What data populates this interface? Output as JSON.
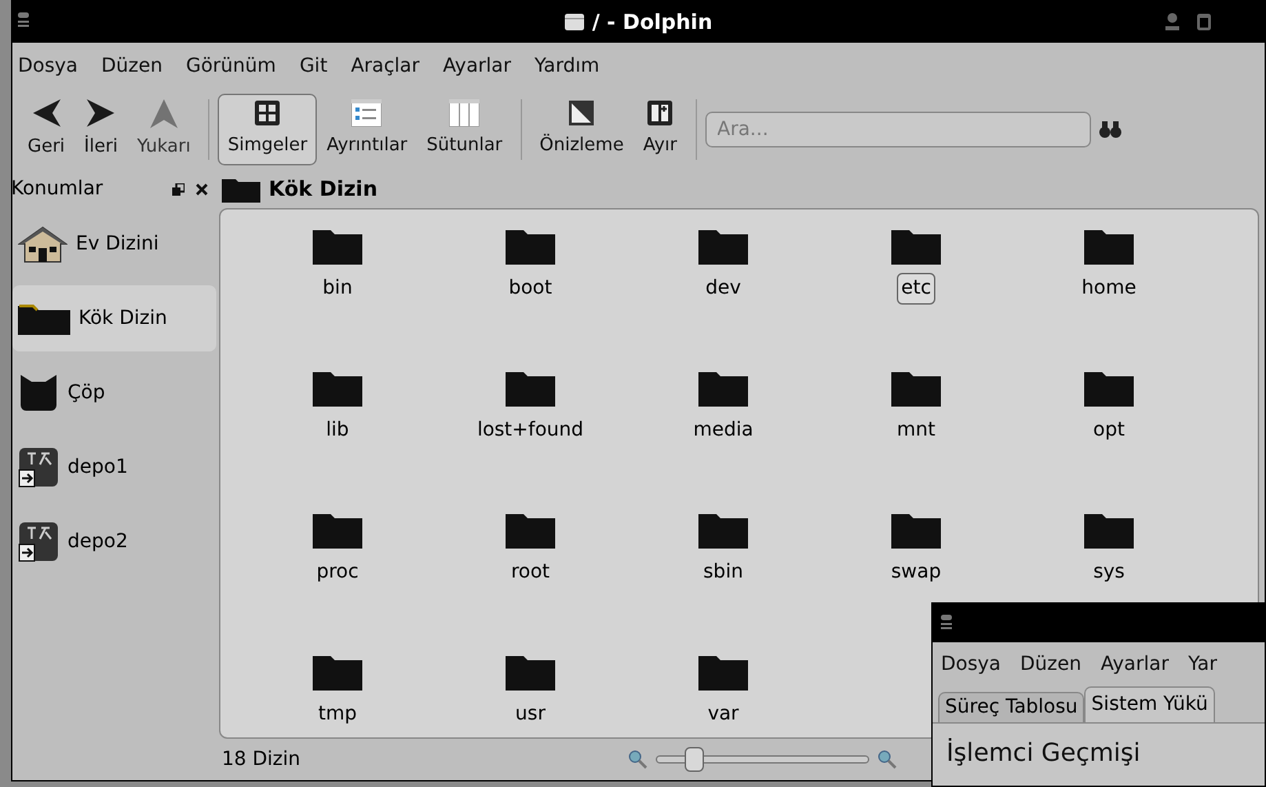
{
  "window": {
    "title": "/ - Dolphin"
  },
  "menu": [
    "Dosya",
    "Düzen",
    "Görünüm",
    "Git",
    "Araçlar",
    "Ayarlar",
    "Yardım"
  ],
  "toolbar": [
    {
      "kind": "back",
      "label": "Geri",
      "disabled": false,
      "selected": false
    },
    {
      "kind": "forward",
      "label": "İleri",
      "disabled": false,
      "selected": false
    },
    {
      "kind": "up",
      "label": "Yukarı",
      "disabled": true,
      "selected": false
    },
    {
      "kind": "icons",
      "label": "Simgeler",
      "disabled": false,
      "selected": true
    },
    {
      "kind": "details",
      "label": "Ayrıntılar",
      "disabled": false,
      "selected": false
    },
    {
      "kind": "columns",
      "label": "Sütunlar",
      "disabled": false,
      "selected": false
    },
    {
      "kind": "preview",
      "label": "Önizleme",
      "disabled": false,
      "selected": false
    },
    {
      "kind": "split",
      "label": "Ayır",
      "disabled": false,
      "selected": false
    }
  ],
  "search": {
    "placeholder": "Ara..."
  },
  "places": {
    "title": "Konumlar",
    "items": [
      {
        "kind": "home",
        "label": "Ev Dizini",
        "selected": false
      },
      {
        "kind": "folder",
        "label": "Kök Dizin",
        "selected": true
      },
      {
        "kind": "trash",
        "label": "Çöp",
        "selected": false
      },
      {
        "kind": "drive",
        "label": "depo1",
        "selected": false
      },
      {
        "kind": "drive",
        "label": "depo2",
        "selected": false
      }
    ]
  },
  "breadcrumb": "Kök Dizin",
  "files": [
    {
      "name": "bin",
      "selected": false
    },
    {
      "name": "boot",
      "selected": false
    },
    {
      "name": "dev",
      "selected": false
    },
    {
      "name": "etc",
      "selected": true
    },
    {
      "name": "home",
      "selected": false
    },
    {
      "name": "lib",
      "selected": false
    },
    {
      "name": "lost+found",
      "selected": false
    },
    {
      "name": "media",
      "selected": false
    },
    {
      "name": "mnt",
      "selected": false
    },
    {
      "name": "opt",
      "selected": false
    },
    {
      "name": "proc",
      "selected": false
    },
    {
      "name": "root",
      "selected": false
    },
    {
      "name": "sbin",
      "selected": false
    },
    {
      "name": "swap",
      "selected": false
    },
    {
      "name": "sys",
      "selected": false
    },
    {
      "name": "tmp",
      "selected": false
    },
    {
      "name": "usr",
      "selected": false
    },
    {
      "name": "var",
      "selected": false
    }
  ],
  "status_bar": {
    "text": "18 Dizin",
    "zoom": {
      "level": 0.15
    }
  },
  "second_window": {
    "menu": [
      "Dosya",
      "Düzen",
      "Ayarlar",
      "Yar"
    ],
    "tabs": [
      {
        "label": "Süreç Tablosu",
        "selected": false
      },
      {
        "label": "Sistem Yükü",
        "selected": true
      }
    ],
    "heading": "İşlemci Geçmişi"
  }
}
